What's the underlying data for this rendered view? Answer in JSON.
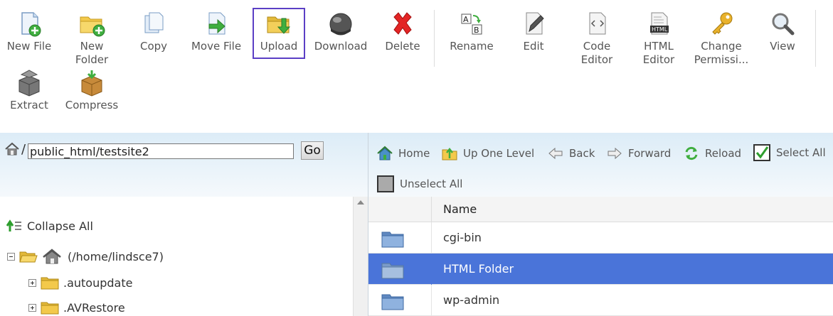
{
  "toolbar": {
    "new_file": "New File",
    "new_folder": "New\nFolder",
    "copy": "Copy",
    "move_file": "Move File",
    "upload": "Upload",
    "download": "Download",
    "delete": "Delete",
    "rename": "Rename",
    "edit": "Edit",
    "code_editor": "Code\nEditor",
    "html_editor": "HTML\nEditor",
    "change_permissions": "Change\nPermissi...",
    "view": "View",
    "extract": "Extract",
    "compress": "Compress",
    "html_icon_text": "HTML"
  },
  "path": {
    "slash": "/",
    "value": "public_html/testsite2",
    "go_label": "Go"
  },
  "nav": {
    "home": "Home",
    "up_one_level": "Up One Level",
    "back": "Back",
    "forward": "Forward",
    "reload": "Reload",
    "select_all": "Select All",
    "unselect_all": "Unselect All"
  },
  "tree": {
    "collapse_all": "Collapse All",
    "root": "(/home/lindsce7)",
    "items": [
      ".autoupdate",
      ".AVRestore"
    ]
  },
  "table": {
    "header_name": "Name",
    "rows": [
      {
        "name": "cgi-bin",
        "selected": false
      },
      {
        "name": "HTML Folder",
        "selected": true
      },
      {
        "name": "wp-admin",
        "selected": false
      }
    ]
  },
  "colors": {
    "selection": "#4a74d9",
    "upload_highlight": "#5b3fc5",
    "folder_blue": "#7fa5d6",
    "folder_yellow": "#f3c94b"
  }
}
